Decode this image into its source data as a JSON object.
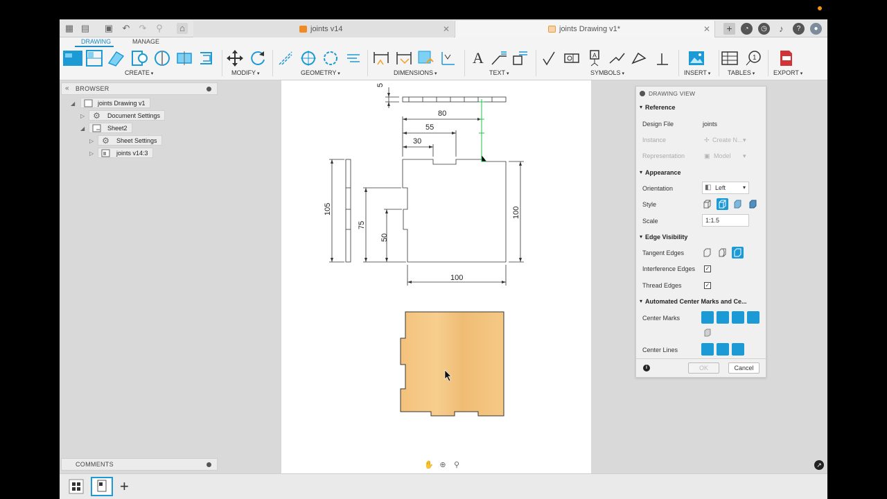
{
  "tabs": {
    "inactive_label": "joints v14",
    "active_label": "joints Drawing v1*"
  },
  "ribbon": {
    "tabs": [
      "DRAWING",
      "MANAGE"
    ],
    "groups": {
      "create": "CREATE",
      "modify": "MODIFY",
      "geometry": "GEOMETRY",
      "dimensions": "DIMENSIONS",
      "text": "TEXT",
      "symbols": "SYMBOLS",
      "insert": "INSERT",
      "tables": "TABLES",
      "export": "EXPORT"
    },
    "accent": "#1c8bc7"
  },
  "browser": {
    "title": "BROWSER",
    "items": [
      {
        "label": "joints Drawing v1"
      },
      {
        "label": "Document Settings"
      },
      {
        "label": "Sheet2"
      },
      {
        "label": "Sheet Settings"
      },
      {
        "label": "joints v14:3"
      }
    ]
  },
  "comments": {
    "title": "COMMENTS"
  },
  "drawing": {
    "dims": {
      "top_small": "5",
      "w80": "80",
      "w55": "55",
      "w30": "30",
      "h105": "105",
      "h75": "75",
      "h50": "50",
      "h100": "100",
      "w100": "100"
    },
    "wood_color": "#f1c07a"
  },
  "dialog": {
    "title": "DRAWING VIEW",
    "sections": {
      "reference": "Reference",
      "appearance": "Appearance",
      "edge_visibility": "Edge Visibility",
      "center": "Automated Center Marks and Ce..."
    },
    "rows": {
      "design_file_label": "Design File",
      "design_file_value": "joints",
      "instance_label": "Instance",
      "instance_value": "Create N...",
      "representation_label": "Representation",
      "representation_value": "Model",
      "orientation_label": "Orientation",
      "orientation_value": "Left",
      "style_label": "Style",
      "scale_label": "Scale",
      "scale_value": "1:1.5",
      "tangent_label": "Tangent Edges",
      "interference_label": "Interference Edges",
      "thread_label": "Thread Edges",
      "center_marks_label": "Center Marks",
      "center_lines_label": "Center Lines"
    },
    "ok": "OK",
    "cancel": "Cancel"
  }
}
